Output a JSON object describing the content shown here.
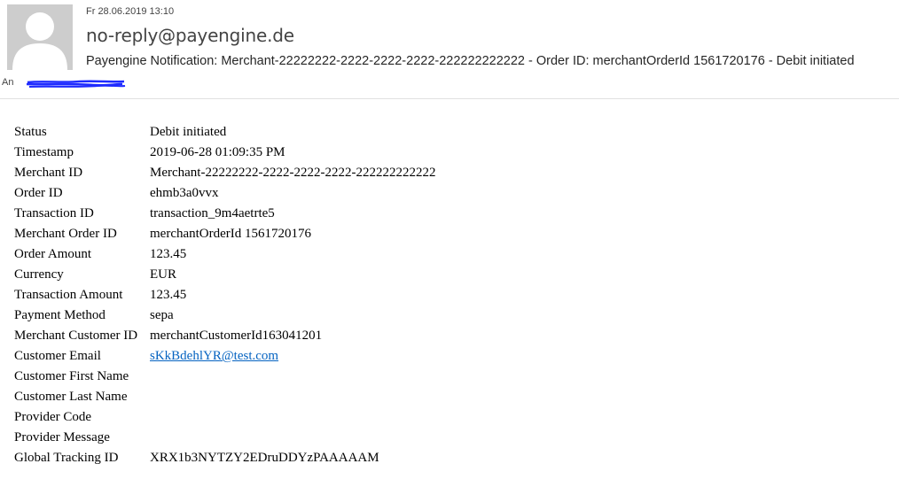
{
  "email": {
    "date": "Fr 28.06.2019 13:10",
    "sender": "no-reply@payengine.de",
    "subject": "Payengine Notification: Merchant-22222222-2222-2222-2222-222222222222 - Order ID: merchantOrderId 1561720176 - Debit initiated",
    "to_label": "An"
  },
  "details": {
    "rows": [
      {
        "label": "Status",
        "value": "Debit initiated"
      },
      {
        "label": "Timestamp",
        "value": "2019-06-28 01:09:35 PM"
      },
      {
        "label": "Merchant ID",
        "value": "Merchant-22222222-2222-2222-2222-222222222222"
      },
      {
        "label": "Order ID",
        "value": "ehmb3a0vvx"
      },
      {
        "label": "Transaction ID",
        "value": "transaction_9m4aetrte5"
      },
      {
        "label": "Merchant Order ID",
        "value": "merchantOrderId 1561720176"
      },
      {
        "label": "Order Amount",
        "value": "123.45"
      },
      {
        "label": "Currency",
        "value": "EUR"
      },
      {
        "label": "Transaction Amount",
        "value": "123.45"
      },
      {
        "label": "Payment Method",
        "value": "sepa"
      },
      {
        "label": "Merchant Customer ID",
        "value": "merchantCustomerId163041201"
      },
      {
        "label": "Customer Email",
        "value": "sKkBdehlYR@test.com"
      },
      {
        "label": "Customer First Name",
        "value": ""
      },
      {
        "label": "Customer Last Name",
        "value": ""
      },
      {
        "label": "Provider Code",
        "value": ""
      },
      {
        "label": "Provider Message",
        "value": ""
      },
      {
        "label": "Global Tracking ID",
        "value": "XRX1b3NYTZY2EDruDDYzPAAAAAM"
      }
    ]
  },
  "colors": {
    "link": "#0563c1",
    "redaction": "#1f2bff",
    "avatar_bg": "#cdcdcd"
  },
  "icons": {
    "avatar": "person-silhouette-icon"
  }
}
